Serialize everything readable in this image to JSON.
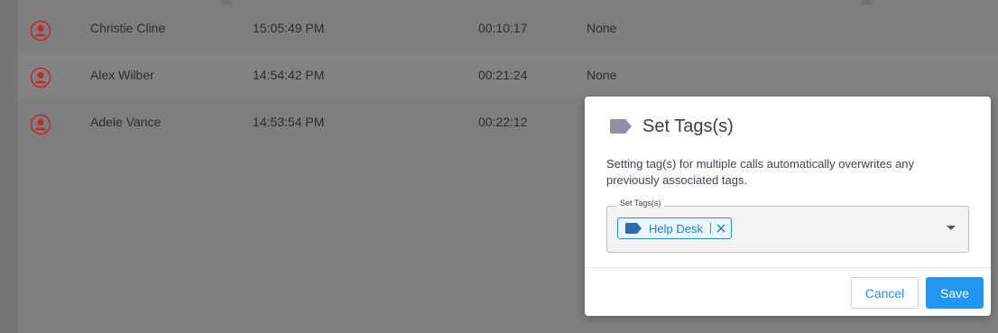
{
  "calls": [
    {
      "name": "Christie Cline",
      "time": "15:05:49 PM",
      "duration": "00:10:17",
      "tags": "None"
    },
    {
      "name": "Alex Wilber",
      "time": "14:54:42 PM",
      "duration": "00:21:24",
      "tags": "None"
    },
    {
      "name": "Adele Vance",
      "time": "14:53:54 PM",
      "duration": "00:22:12",
      "tags": ""
    }
  ],
  "modal": {
    "title": "Set Tags(s)",
    "description": "Setting tag(s) for multiple calls automatically overwrites any previously associated tags.",
    "field_label": "Set Tags(s)",
    "selected_tags": [
      {
        "label": "Help Desk",
        "icon": "tag-icon"
      }
    ],
    "cancel_label": "Cancel",
    "save_label": "Save",
    "icon": "tag-icon"
  },
  "colors": {
    "accent": "#2196f3",
    "avatar_red": "#c62828",
    "title_tag_icon": "#8e8ea0"
  }
}
